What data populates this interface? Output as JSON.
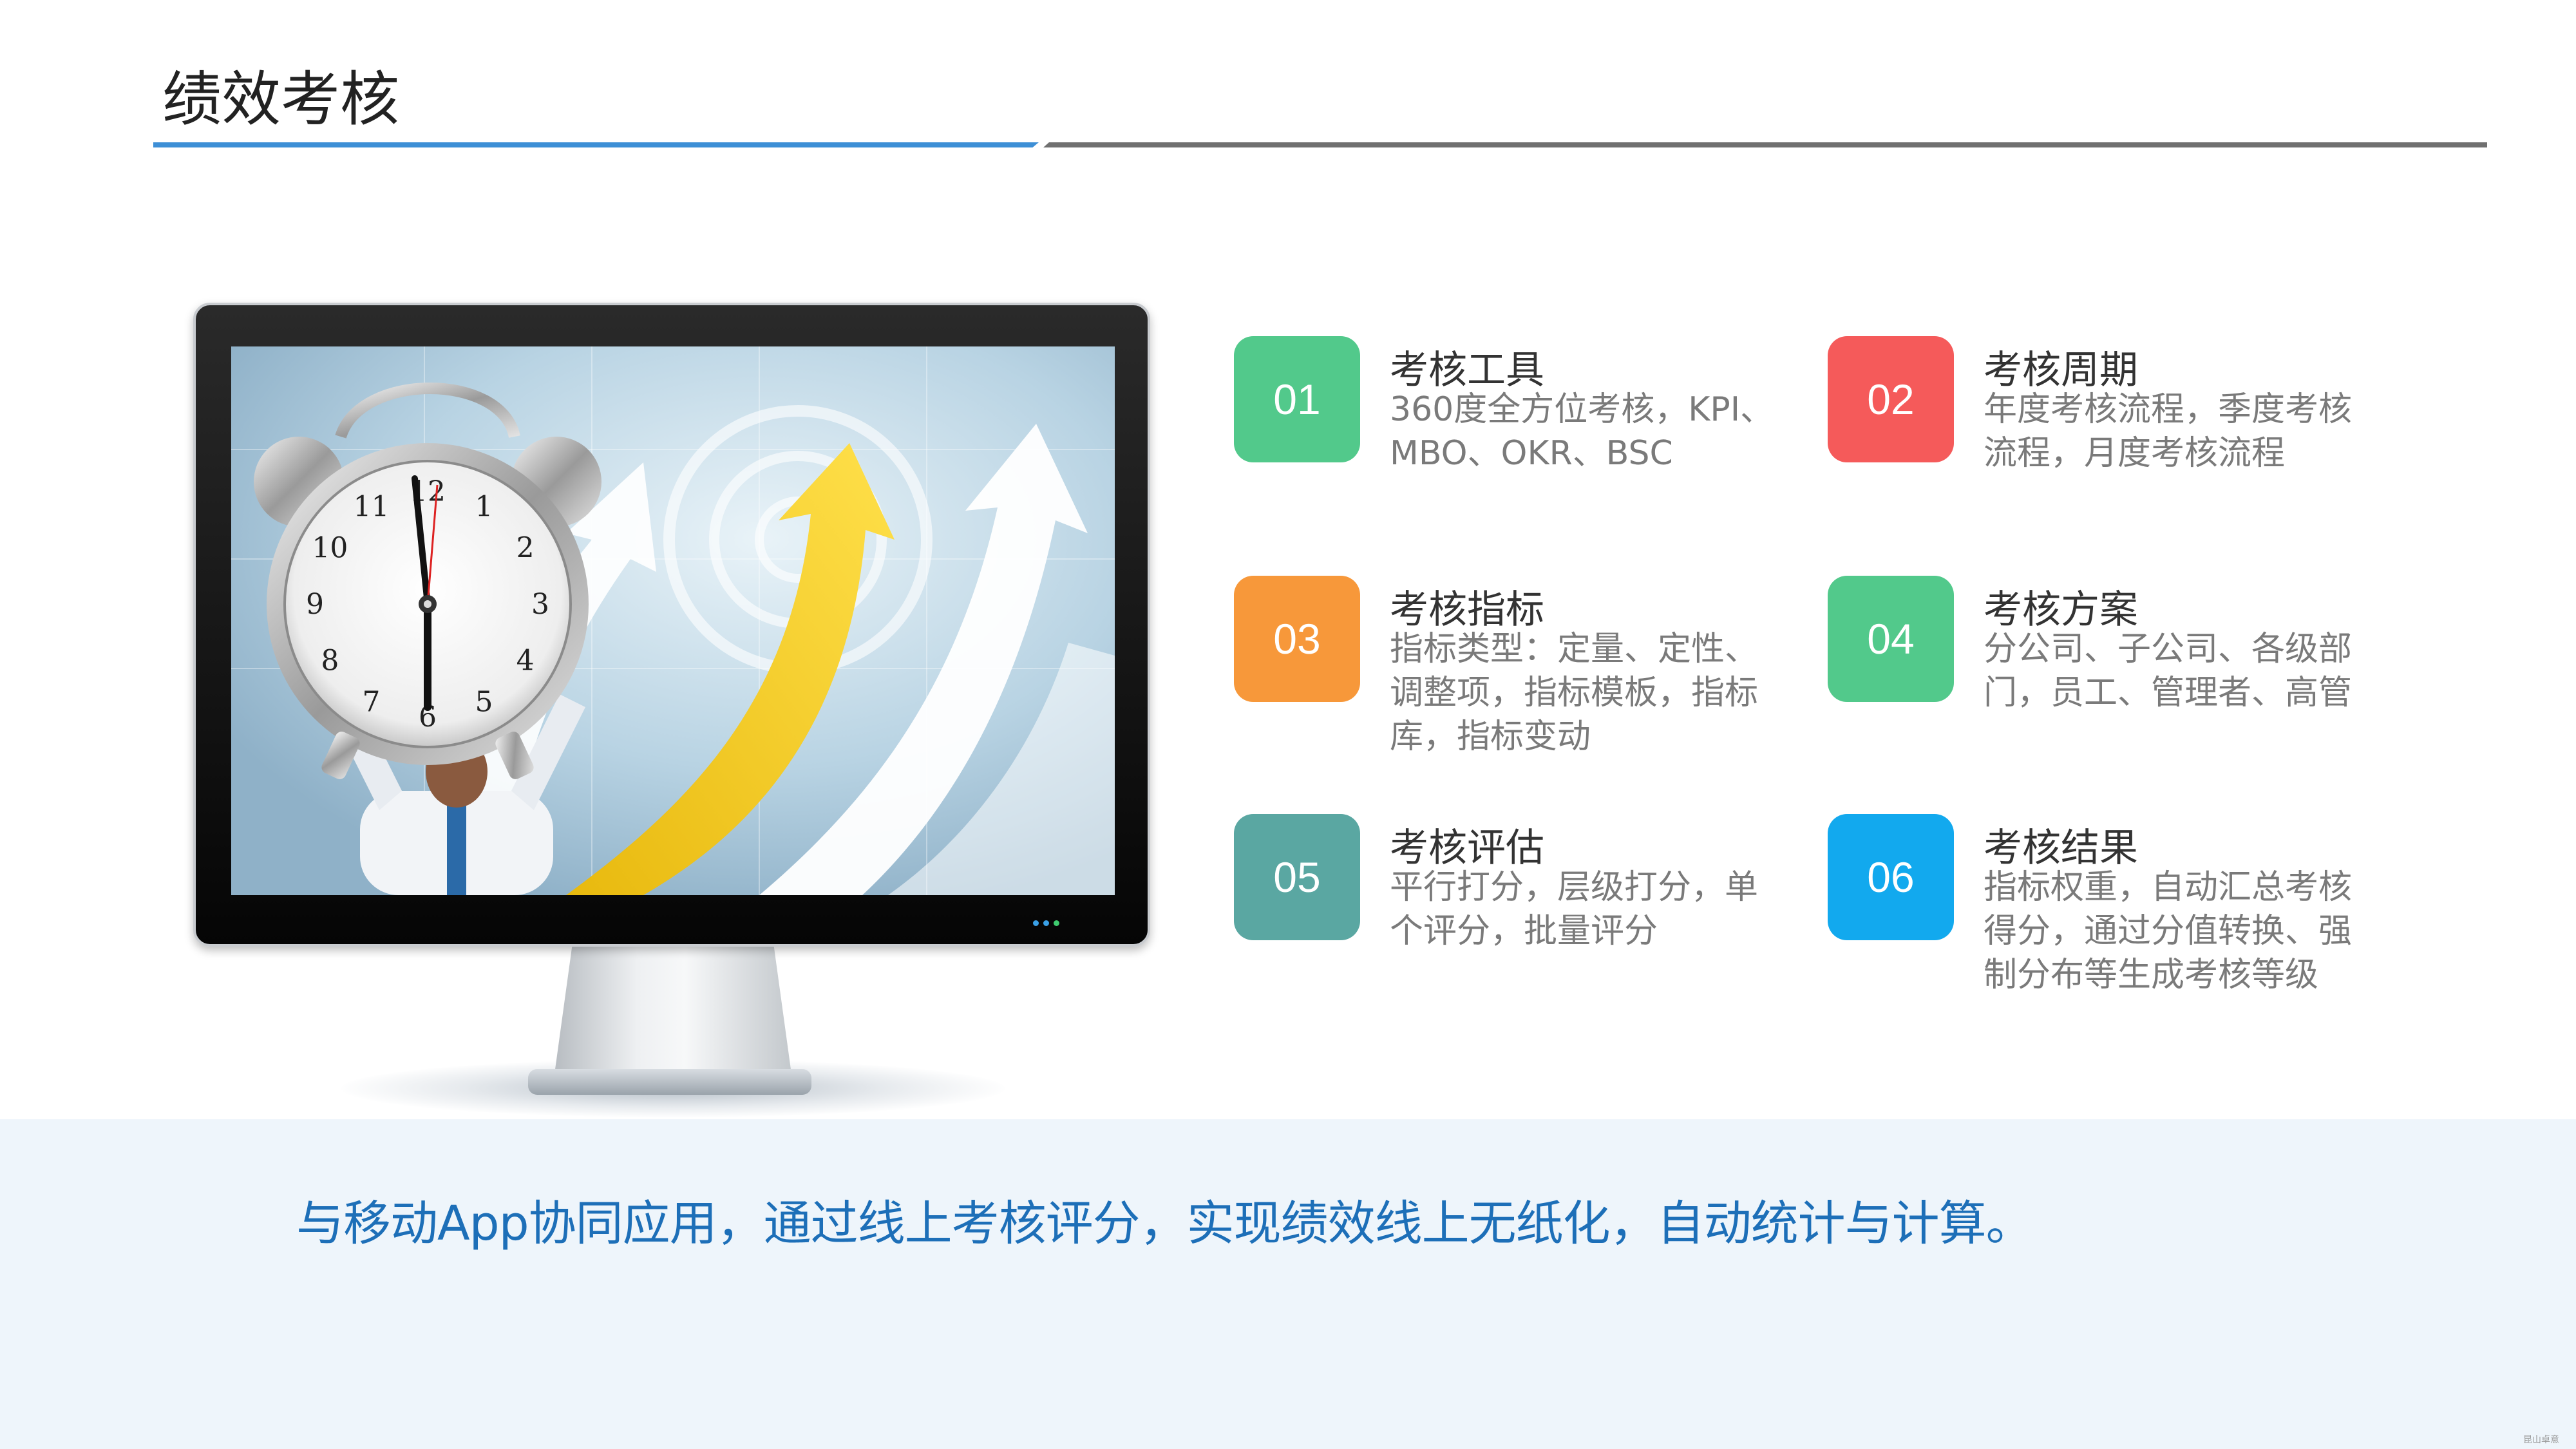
{
  "header": {
    "title": "绩效考核"
  },
  "colors": {
    "accent_blue": "#3d8fd6",
    "rule_gray": "#707070",
    "tagline_blue": "#1d6fb8",
    "band_bg": "#eef5fb"
  },
  "features": [
    {
      "number": "01",
      "title": "考核工具",
      "description": "360度全方位考核，KPI、MBO、OKR、BSC",
      "color": "#52c98b"
    },
    {
      "number": "02",
      "title": "考核周期",
      "description": "年度考核流程，季度考核流程，月度考核流程",
      "color": "#f55a5a"
    },
    {
      "number": "03",
      "title": "考核指标",
      "description": "指标类型：定量、定性、调整项，指标模板，指标库，指标变动",
      "color": "#f7983a"
    },
    {
      "number": "04",
      "title": "考核方案",
      "description": "分公司、子公司、各级部门，员工、管理者、高管",
      "color": "#52c98b"
    },
    {
      "number": "05",
      "title": "考核评估",
      "description": "平行打分，层级打分，单个评分，批量评分",
      "color": "#5aa7a2"
    },
    {
      "number": "06",
      "title": "考核结果",
      "description": "指标权重，自动汇总考核得分，通过分值转换、强制分布等生成考核等级",
      "color": "#12a9ee"
    }
  ],
  "footer": {
    "tagline": "与移动App协同应用，通过线上考核评分，实现绩效线上无纸化，自动统计与计算。"
  },
  "watermark": "昆山卓意",
  "monitor": {
    "clock_numerals": [
      "12",
      "1",
      "2",
      "3",
      "4",
      "5",
      "6",
      "7",
      "8",
      "9",
      "10",
      "11"
    ]
  }
}
